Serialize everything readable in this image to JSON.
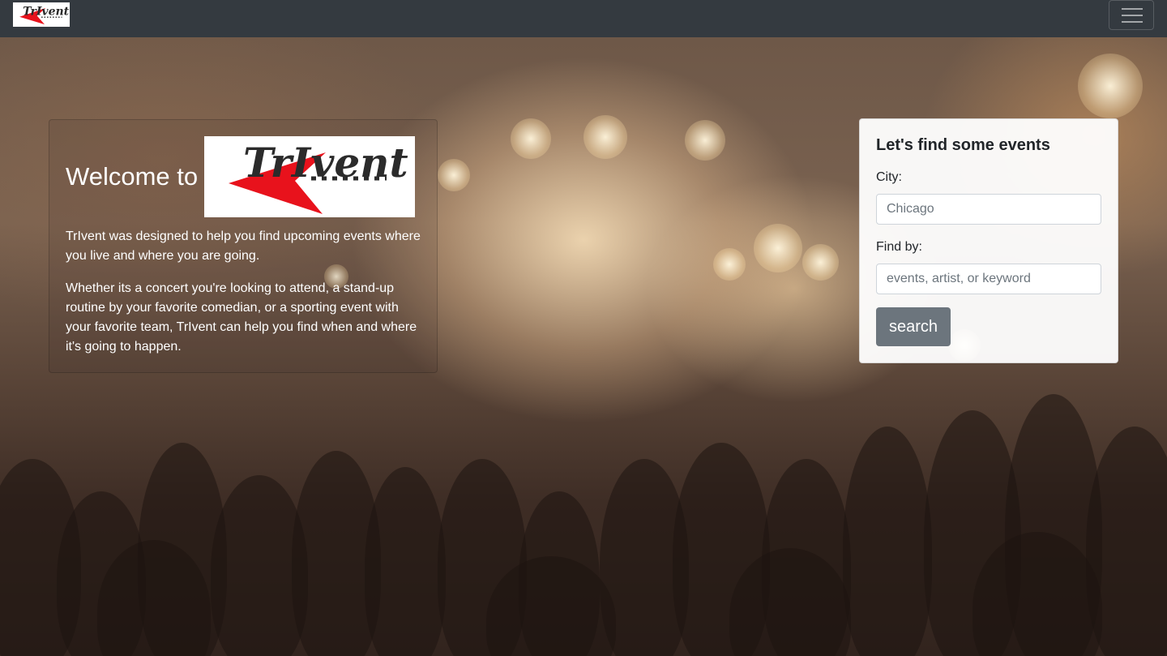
{
  "brand": {
    "logo_text": "TrIvent",
    "logo_accent_color": "#e8121c",
    "logo_text_color": "#2b2b2b"
  },
  "navbar": {
    "toggler_icon": "hamburger-menu-icon",
    "background": "#343a40"
  },
  "welcome": {
    "title": "Welcome to",
    "paragraph1": "TrIvent was designed to help you find upcoming events where you live and where you are going.",
    "paragraph2": "Whether its a concert you're looking to attend, a stand-up routine by your favorite comedian, or a sporting event with your favorite team, TrIvent can help you find when and where it's going to happen."
  },
  "search": {
    "title": "Let's find some events",
    "city_label": "City:",
    "city_placeholder": "Chicago",
    "find_label": "Find by:",
    "find_placeholder": "events, artist, or keyword",
    "button_label": "search",
    "button_color": "#6c757d"
  }
}
